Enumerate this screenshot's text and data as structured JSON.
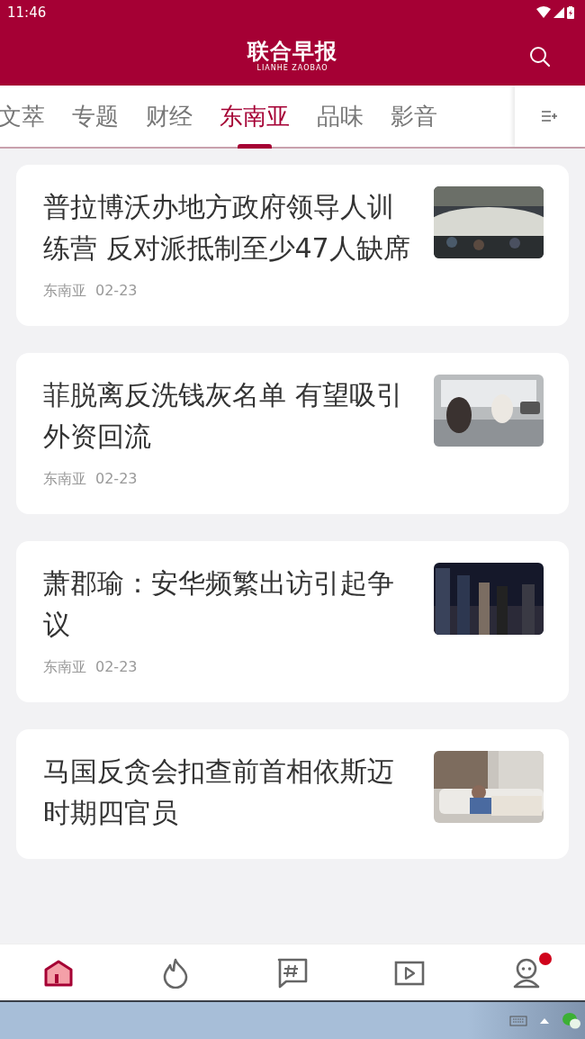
{
  "status_bar": {
    "time": "11:46"
  },
  "header": {
    "logo": "联合早报",
    "logo_sub": "LIANHE ZAOBAO"
  },
  "tabs": [
    {
      "label": "文萃",
      "selected": false
    },
    {
      "label": "专题",
      "selected": false
    },
    {
      "label": "财经",
      "selected": false
    },
    {
      "label": "东南亚",
      "selected": true
    },
    {
      "label": "品味",
      "selected": false
    },
    {
      "label": "影音",
      "selected": false
    }
  ],
  "articles": [
    {
      "title": "普拉博沃办地方政府领导人训练营 反对派抵制至少47人缺席",
      "section": "东南亚",
      "date": "02-23"
    },
    {
      "title": "菲脱离反洗钱灰名单 有望吸引外资回流",
      "section": "东南亚",
      "date": "02-23"
    },
    {
      "title": "萧郡瑜：安华频繁出访引起争议",
      "section": "东南亚",
      "date": "02-23"
    },
    {
      "title": "马国反贪会扣查前首相依斯迈时期四官员"
    }
  ],
  "bottom_nav": [
    {
      "kind": "home",
      "selected": true
    },
    {
      "kind": "hot",
      "selected": false
    },
    {
      "kind": "topic",
      "selected": false
    },
    {
      "kind": "video",
      "selected": false
    },
    {
      "kind": "profile",
      "selected": false,
      "badge": true
    }
  ]
}
